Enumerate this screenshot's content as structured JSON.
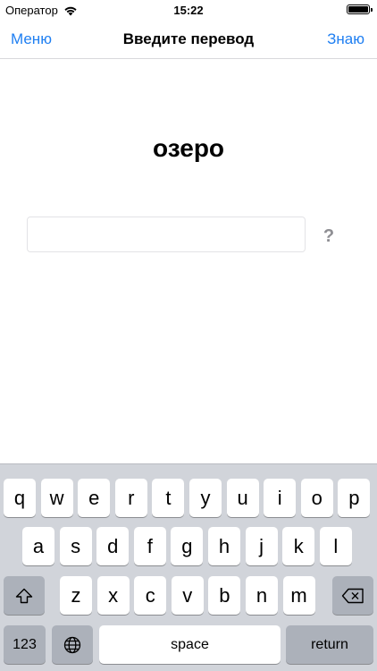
{
  "status_bar": {
    "carrier": "Оператор",
    "time": "15:22",
    "wifi_icon": "wifi-icon",
    "battery_icon": "battery-icon"
  },
  "nav": {
    "left_label": "Меню",
    "title": "Введите перевод",
    "right_label": "Знаю"
  },
  "quiz": {
    "word": "озеро",
    "answer_value": "",
    "hint_label": "?"
  },
  "keyboard": {
    "row1": [
      "q",
      "w",
      "e",
      "r",
      "t",
      "y",
      "u",
      "i",
      "o",
      "p"
    ],
    "row2": [
      "a",
      "s",
      "d",
      "f",
      "g",
      "h",
      "j",
      "k",
      "l"
    ],
    "row3": [
      "z",
      "x",
      "c",
      "v",
      "b",
      "n",
      "m"
    ],
    "numbers_label": "123",
    "space_label": "space",
    "return_label": "return",
    "shift_icon": "shift-icon",
    "delete_icon": "delete-icon",
    "globe_icon": "globe-icon"
  },
  "colors": {
    "accent": "#1f7ff2",
    "keyboard_bg": "#d1d4da",
    "dark_key": "#acb1ba"
  }
}
